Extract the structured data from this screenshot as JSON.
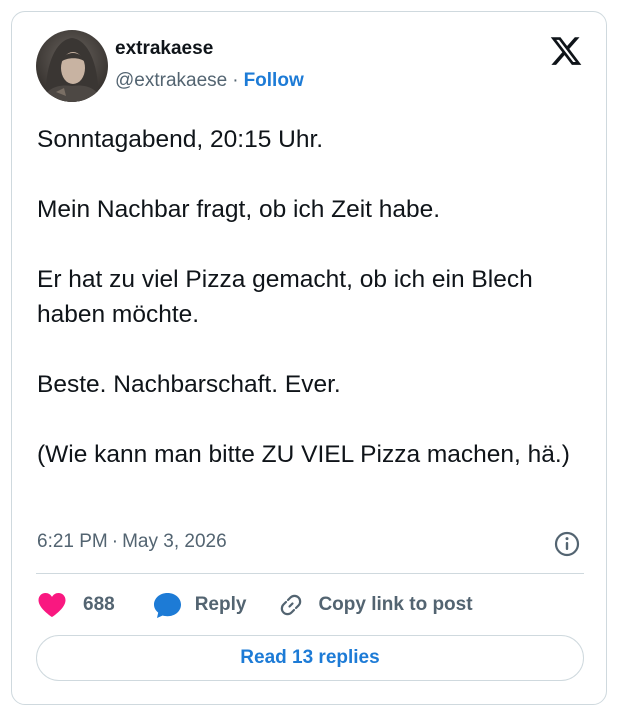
{
  "author": {
    "display_name": "extrakaese",
    "handle": "@extrakaese",
    "separator": "·",
    "follow_label": "Follow",
    "avatar_icon": "user-avatar-hooded-person"
  },
  "brand": {
    "logo_icon": "x-logo-icon"
  },
  "tweet": {
    "paragraphs": [
      "Sonntagabend, 20:15 Uhr.",
      "Mein Nachbar fragt, ob ich Zeit habe.",
      "Er hat zu viel Pizza gemacht, ob ich ein Blech haben möchte.",
      "Beste. Nachbarschaft. Ever.",
      "(Wie kann man bitte ZU VIEL Pizza machen, hä.)"
    ],
    "time": "6:21 PM",
    "date_separator": "·",
    "date": "May 3, 2026"
  },
  "actions": {
    "like_count": "688",
    "reply_label": "Reply",
    "copy_link_label": "Copy link to post",
    "read_replies_label": "Read 13 replies"
  },
  "colors": {
    "accent": "#1d7bd6",
    "like": "#f91880",
    "reply_bubble": "#1d7bd6",
    "secondary_text": "#536471",
    "border": "#cfd9de"
  }
}
